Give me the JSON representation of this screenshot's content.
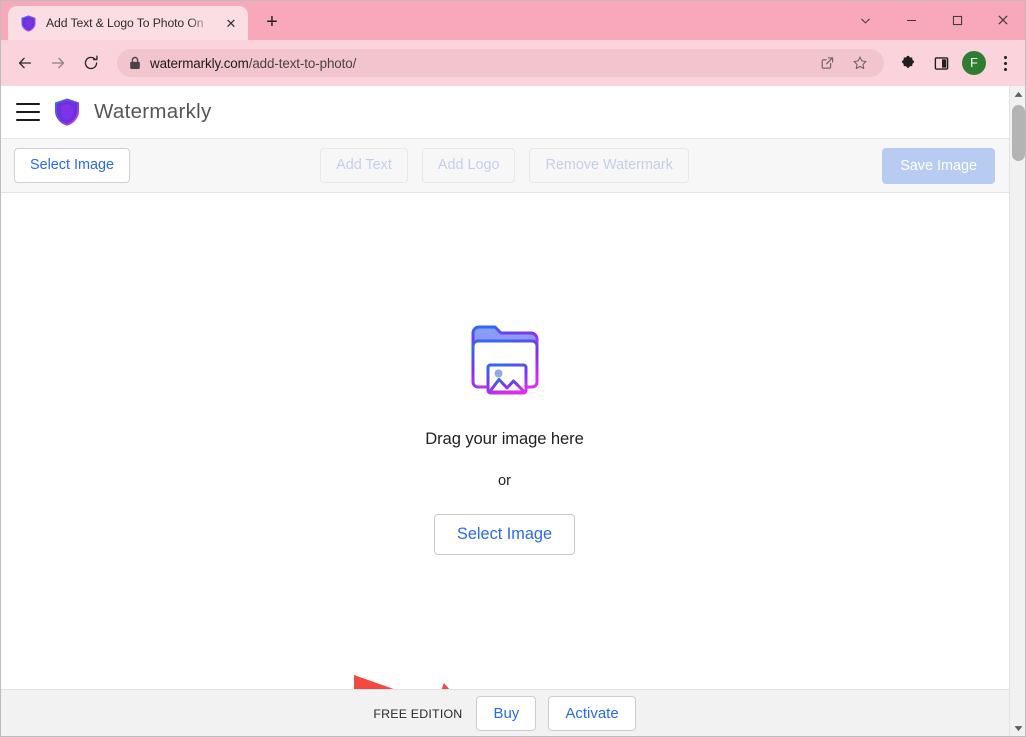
{
  "browser": {
    "tab": {
      "title": "Add Text & Logo To Photo On",
      "favicon_name": "watermarkly-shield-favicon",
      "close_label": "✕"
    },
    "new_tab_label": "+",
    "window_controls": {
      "minimize_to_tray_label": "⌄",
      "minimize_label": "–",
      "maximize_label": "□",
      "close_label": "✕"
    },
    "nav": {
      "back_label": "←",
      "forward_label": "→",
      "reload_label": "⟳"
    },
    "omnibox": {
      "lock_icon": "site-info-lock-icon",
      "url_host": "watermarkly.com",
      "url_path": "/add-text-to-photo/",
      "url_full": "watermarkly.com/add-text-to-photo/",
      "share_icon": "share-icon",
      "bookmark_icon": "star-icon"
    },
    "actions": {
      "extensions_icon": "puzzle-piece-icon",
      "side_panel_icon": "side-panel-icon",
      "profile_initial": "F",
      "menu_icon": "three-dot-menu-icon"
    },
    "theme": {
      "tabstrip_bg": "#f9a8ba",
      "toolbar_bg": "#fbd3dc",
      "active_tab_bg": "#fbdde4",
      "omnibox_bg": "#f2c4ce",
      "avatar_bg": "#2e7d32"
    }
  },
  "app": {
    "header": {
      "menu_icon": "hamburger-menu-icon",
      "logo_icon": "watermarkly-shield-logo",
      "brand": "Watermarkly"
    },
    "action_bar": {
      "select_image": "Select Image",
      "add_text": "Add Text",
      "add_logo": "Add Logo",
      "remove_watermark": "Remove Watermark",
      "save_image": "Save Image",
      "save_button_bg": "#b8cbf0",
      "link_color": "#2a6ae8",
      "disabled_color": "#c3cfea"
    },
    "canvas": {
      "folder_icon": "folder-with-photo-icon",
      "drag_text": "Drag your image here",
      "or_text": "or",
      "select_image": "Select Image",
      "annotation": {
        "shape": "red-arrow",
        "color": "#f24a40",
        "points_to": "Select Image"
      }
    },
    "footer": {
      "edition": "FREE EDITION",
      "buy": "Buy",
      "activate": "Activate"
    }
  },
  "scrollbar": {
    "up_arrow": "scroll-up-arrow",
    "down_arrow": "scroll-down-arrow"
  }
}
